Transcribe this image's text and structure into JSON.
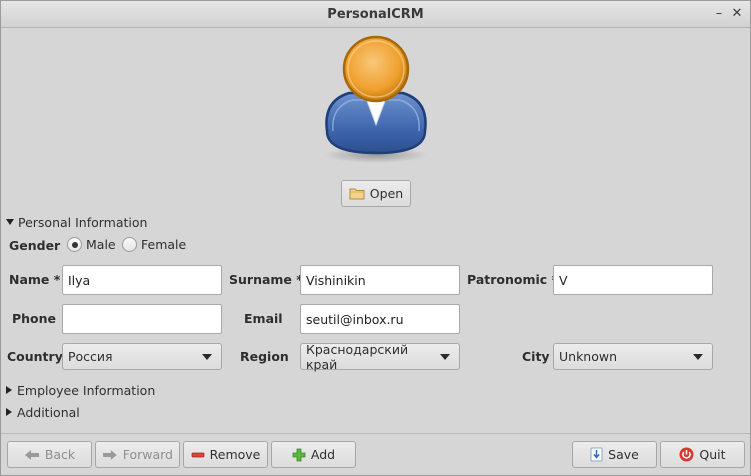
{
  "window": {
    "title": "PersonalCRM"
  },
  "photo": {
    "open_label": "Open"
  },
  "sections": {
    "personal": "Personal Information",
    "employee": "Employee Information",
    "additional": "Additional"
  },
  "gender": {
    "label": "Gender",
    "options": [
      "Male",
      "Female"
    ],
    "selected": "Male"
  },
  "fields": {
    "name_label": "Name",
    "name_value": "Ilya",
    "surname_label": "Surname",
    "surname_value": "Vishinikin",
    "patronomic_label": "Patronomic",
    "patronomic_value": "V",
    "required_mark": "*",
    "phone_label": "Phone",
    "phone_value": "",
    "email_label": "Email",
    "email_value": "seutil@inbox.ru",
    "country_label": "Country",
    "country_value": "Россия",
    "region_label": "Region",
    "region_value": "Краснодарский край",
    "city_label": "City",
    "city_value": "Unknown"
  },
  "toolbar": {
    "back": "Back",
    "forward": "Forward",
    "remove": "Remove",
    "add": "Add",
    "save": "Save",
    "quit": "Quit"
  },
  "icons": {
    "avatar": "person-avatar-icon",
    "open": "folder-icon",
    "back": "arrow-left-icon",
    "forward": "arrow-right-icon",
    "remove": "minus-icon",
    "add": "plus-icon",
    "save": "save-icon",
    "quit": "power-icon"
  }
}
